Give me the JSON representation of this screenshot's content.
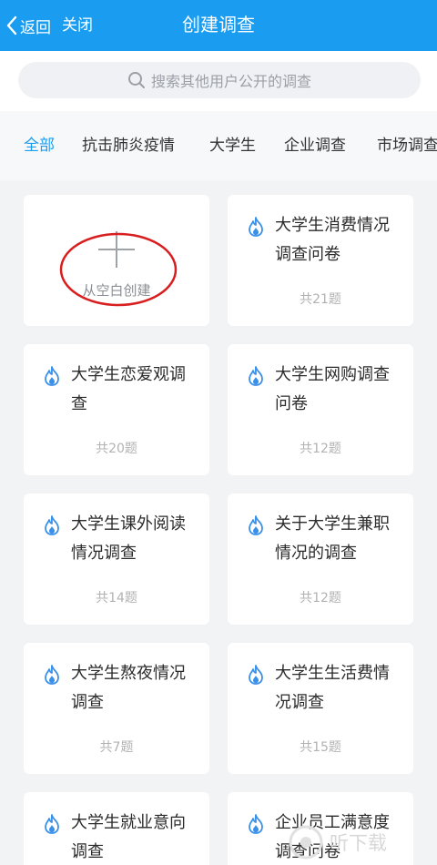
{
  "header": {
    "back_label": "返回",
    "close_label": "关闭",
    "title": "创建调查"
  },
  "search": {
    "placeholder": "搜索其他用户公开的调查"
  },
  "tabs": [
    {
      "label": "全部",
      "active": true
    },
    {
      "label": "抗击肺炎疫情"
    },
    {
      "label": "大学生"
    },
    {
      "label": "企业调查"
    },
    {
      "label": "市场调查"
    }
  ],
  "blank_card": {
    "label": "从空白创建"
  },
  "surveys": [
    {
      "title": "大学生消费情况调查问卷",
      "count": "共21题"
    },
    {
      "title": "大学生恋爱观调查",
      "count": "共20题"
    },
    {
      "title": "大学生网购调查问卷",
      "count": "共12题"
    },
    {
      "title": "大学生课外阅读情况调查",
      "count": "共14题"
    },
    {
      "title": "关于大学生兼职情况的调查",
      "count": "共12题"
    },
    {
      "title": "大学生熬夜情况调查",
      "count": "共7题"
    },
    {
      "title": "大学生生活费情况调查",
      "count": "共15题"
    },
    {
      "title": "大学生就业意向调查",
      "count": ""
    },
    {
      "title": "企业员工满意度调查问卷",
      "count": ""
    }
  ],
  "watermark": {
    "text": "听下载"
  },
  "colors": {
    "accent": "#1a9df0",
    "flame": "#3a8fe8",
    "annotation_circle": "#d81e1e"
  }
}
